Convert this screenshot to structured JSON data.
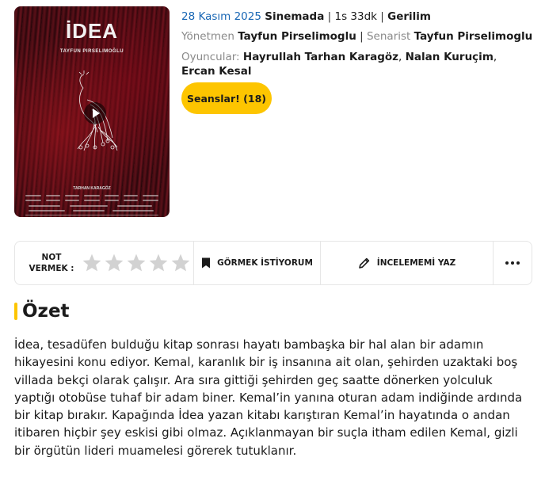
{
  "poster": {
    "title": "İDEA",
    "director_caption": "TAYFUN PIRSELIMOĞLU",
    "actor_caption": "TARHAN KARAGÖZ"
  },
  "meta": {
    "date": "28 Kasım 2025",
    "status": "Sinemada",
    "separator": "|",
    "duration": "1s 33dk",
    "genre": "Gerilim"
  },
  "credits": {
    "director_label": "Yönetmen",
    "director": "Tayfun Pirselimoglu",
    "writer_label": "Senarist",
    "writer": "Tayfun Pirselimoglu"
  },
  "cast": {
    "label": "Oyuncular:",
    "names": [
      "Hayrullah Tarhan Karagöz",
      "Nalan Kuruçim",
      "Ercan Kesal"
    ]
  },
  "sessions_button": "Seanslar! (18)",
  "actions": {
    "rate_label": "NOT VERMEK :",
    "star_count": 5,
    "watchlist": "GÖRMEK İSTİYORUM",
    "review": "İNCELEMEMİ YAZ"
  },
  "summary": {
    "title": "Özet",
    "text": "İdea, tesadüfen bulduğu kitap sonrası hayatı bambaşka bir hal alan bir adamın hikayesini konu ediyor. Kemal, karanlık bir iş insanına ait olan, şehirden uzaktaki boş villada bekçi olarak çalışır. Ara sıra gittiği şehirden geç saatte dönerken yolculuk yaptığı otobüse tuhaf bir adam biner. Kemal’in yanına oturan adam indiğinde ardında bir kitap bırakır. Kapağında İdea yazan kitabı karıştıran Kemal’in hayatında o andan itibaren hiçbir şey eskisi gibi olmaz. Açıklanmayan bir suçla itham edilen Kemal, gizli bir örgütün lideri muamelesi görerek tutuklanır."
  },
  "colors": {
    "accent": "#fdc500",
    "link": "#1866b4",
    "muted": "#8a8a8a",
    "star_empty": "#d2d2d2"
  },
  "icons": [
    "play-icon",
    "star-icon",
    "bookmark-icon",
    "pencil-icon",
    "more-dots-icon"
  ]
}
